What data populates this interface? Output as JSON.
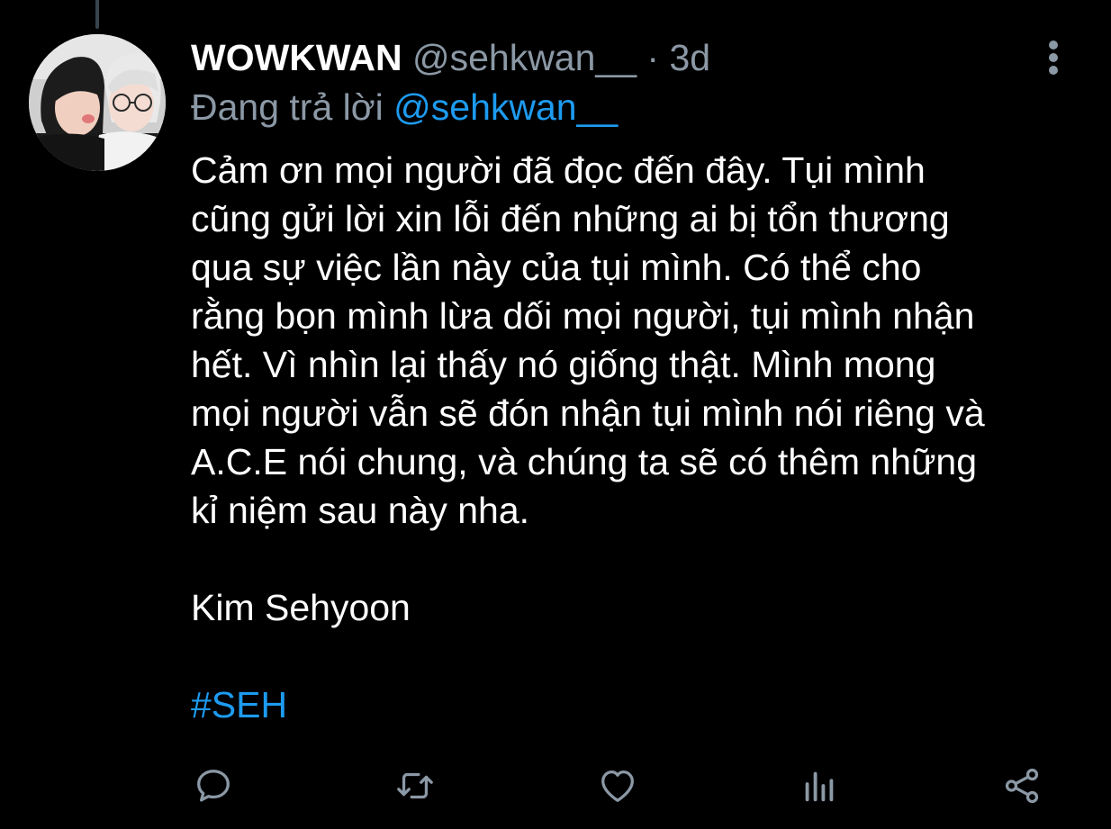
{
  "tweet": {
    "display_name": "WOWKWAN",
    "handle": "@sehkwan__",
    "separator": "·",
    "time": "3d",
    "replying_label": "Đang trả lời",
    "replying_to": "@sehkwan__",
    "body_lines": [
      "Cảm ơn mọi người đã đọc đến đây. Tụi mình",
      "cũng gửi lời xin lỗi đến những ai bị tổn thương",
      "qua sự việc lần này của tụi mình. Có thể cho",
      "rằng bọn mình lừa dối mọi người, tụi mình nhận",
      "hết. Vì nhìn lại thấy nó giống thật. Mình mong",
      "mọi người vẫn sẽ đón nhận tụi mình nói riêng và",
      "A.C.E nói chung, và chúng ta sẽ có thêm những",
      "kỉ niệm sau này nha."
    ],
    "signature": "Kim Sehyoon",
    "hashtag": "#SEH"
  },
  "actions": [
    {
      "name": "reply",
      "icon": "reply-icon"
    },
    {
      "name": "retweet",
      "icon": "retweet-icon"
    },
    {
      "name": "like",
      "icon": "heart-icon"
    },
    {
      "name": "analytics",
      "icon": "analytics-icon"
    },
    {
      "name": "share",
      "icon": "share-icon"
    }
  ],
  "colors": {
    "background": "#000000",
    "text": "#ffffff",
    "secondary": "#8b98a5",
    "accent": "#1d9bf0"
  }
}
